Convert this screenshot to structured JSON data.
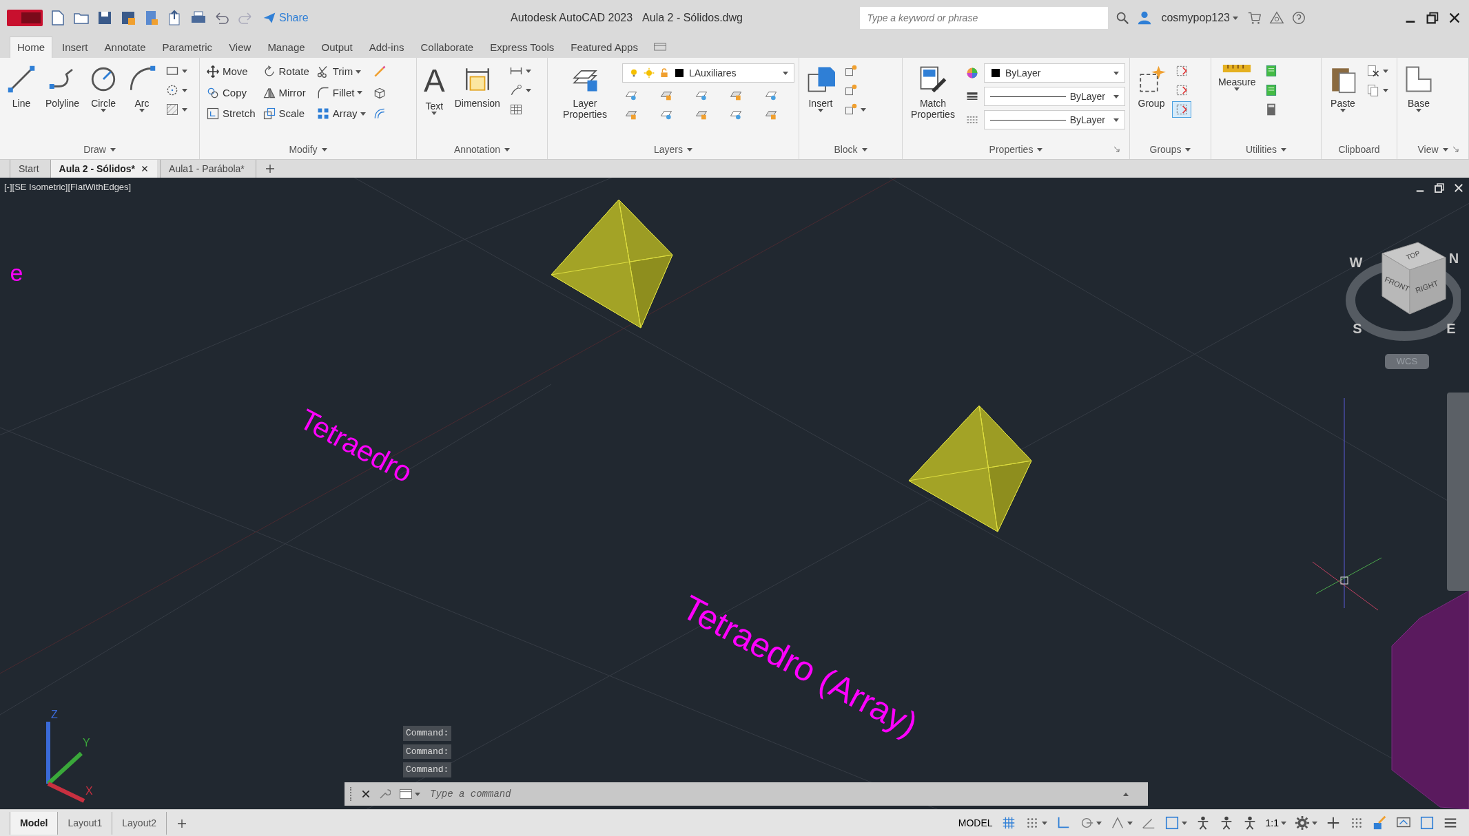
{
  "title_bar": {
    "share": "Share",
    "app_title": "Autodesk AutoCAD 2023",
    "file_name": "Aula 2 - Sólidos.dwg",
    "search": {
      "placeholder": "Type a keyword or phrase"
    },
    "user": "cosmypop123"
  },
  "ribbon_tabs": [
    {
      "label": "Home",
      "selected": true
    },
    {
      "label": "Insert",
      "selected": false
    },
    {
      "label": "Annotate",
      "selected": false
    },
    {
      "label": "Parametric",
      "selected": false
    },
    {
      "label": "View",
      "selected": false
    },
    {
      "label": "Manage",
      "selected": false
    },
    {
      "label": "Output",
      "selected": false
    },
    {
      "label": "Add-ins",
      "selected": false
    },
    {
      "label": "Collaborate",
      "selected": false
    },
    {
      "label": "Express Tools",
      "selected": false
    },
    {
      "label": "Featured Apps",
      "selected": false
    }
  ],
  "ribbon_panels": [
    {
      "title": "Draw",
      "menu": true,
      "launcher": false,
      "large": [
        {
          "label": "Line",
          "dropdown": false
        },
        {
          "label": "Polyline",
          "dropdown": false
        },
        {
          "label": "Circle",
          "dropdown": true
        },
        {
          "label": "Arc",
          "dropdown": true
        }
      ],
      "rows": [
        [
          {
            "kind": "icon",
            "dropdown": true
          }
        ],
        [
          {
            "kind": "icon",
            "dropdown": true
          }
        ],
        [
          {
            "kind": "icon",
            "dropdown": true
          }
        ]
      ]
    },
    {
      "title": "Modify",
      "menu": true,
      "launcher": false,
      "rows": [
        [
          {
            "kind": "small",
            "label": "Move",
            "dropdown": false
          },
          {
            "kind": "small",
            "label": "Rotate",
            "dropdown": false
          },
          {
            "kind": "small",
            "label": "Trim",
            "dropdown": true
          },
          {
            "kind": "icon",
            "dropdown": false
          }
        ],
        [
          {
            "kind": "small",
            "label": "Copy",
            "dropdown": false
          },
          {
            "kind": "small",
            "label": "Mirror",
            "dropdown": false
          },
          {
            "kind": "small",
            "label": "Fillet",
            "dropdown": true
          },
          {
            "kind": "icon",
            "dropdown": false
          }
        ],
        [
          {
            "kind": "small",
            "label": "Stretch",
            "dropdown": false
          },
          {
            "kind": "small",
            "label": "Scale",
            "dropdown": false
          },
          {
            "kind": "small",
            "label": "Array",
            "dropdown": true
          },
          {
            "kind": "icon",
            "dropdown": false
          }
        ]
      ]
    },
    {
      "title": "Annotation",
      "menu": true,
      "launcher": false,
      "large": [
        {
          "label": "Text",
          "glyph": "A",
          "dropdown": true
        },
        {
          "label": "Dimension",
          "dropdown": false
        }
      ],
      "rows": [
        [
          {
            "kind": "icon",
            "dropdown": true
          }
        ],
        [
          {
            "kind": "icon",
            "dropdown": true
          }
        ],
        [
          {
            "kind": "icon",
            "dropdown": false
          }
        ]
      ]
    },
    {
      "title": "Layers",
      "menu": true,
      "launcher": false,
      "large": [
        {
          "label": "Layer Properties",
          "dropdown": false
        }
      ],
      "rows": [
        [
          {
            "kind": "select",
            "value": "LAuxiliares"
          }
        ],
        [
          {
            "kind": "icon",
            "dropdown": false
          },
          {
            "kind": "icon",
            "dropdown": false
          },
          {
            "kind": "icon",
            "dropdown": false
          },
          {
            "kind": "icon",
            "dropdown": false
          },
          {
            "kind": "icon",
            "dropdown": false
          }
        ],
        [
          {
            "kind": "icon",
            "dropdown": false
          },
          {
            "kind": "icon",
            "dropdown": false
          },
          {
            "kind": "icon",
            "dropdown": false
          },
          {
            "kind": "icon",
            "dropdown": false
          },
          {
            "kind": "icon",
            "dropdown": false
          }
        ]
      ]
    },
    {
      "title": "Block",
      "menu": true,
      "launcher": false,
      "large": [
        {
          "label": "Insert",
          "dropdown": true
        }
      ],
      "rows": [
        [
          {
            "kind": "icon",
            "dropdown": false
          }
        ],
        [
          {
            "kind": "icon",
            "dropdown": false
          }
        ],
        [
          {
            "kind": "icon",
            "dropdown": true
          }
        ]
      ]
    },
    {
      "title": "Properties",
      "menu": true,
      "launcher": true,
      "large": [
        {
          "label": "Match Properties",
          "dropdown": false
        }
      ],
      "rows": [
        [
          {
            "kind": "icon",
            "dropdown": false
          },
          {
            "kind": "select",
            "value": "ByLayer"
          }
        ],
        [
          {
            "kind": "icon",
            "dropdown": false
          },
          {
            "kind": "select",
            "value": "ByLayer"
          }
        ],
        [
          {
            "kind": "icon",
            "dropdown": false
          },
          {
            "kind": "select",
            "value": "ByLayer"
          }
        ]
      ]
    },
    {
      "title": "Groups",
      "menu": true,
      "launcher": false,
      "large": [
        {
          "label": "Group",
          "dropdown": false
        }
      ],
      "rows": [
        [
          {
            "kind": "icon",
            "dropdown": false,
            "on": false
          }
        ],
        [
          {
            "kind": "icon",
            "dropdown": false,
            "on": false
          }
        ],
        [
          {
            "kind": "icon",
            "dropdown": false,
            "on": true
          }
        ]
      ]
    },
    {
      "title": "Utilities",
      "menu": true,
      "launcher": false,
      "large": [
        {
          "label": "Measure",
          "dropdown": true
        }
      ],
      "rows": [
        [
          {
            "kind": "icon",
            "dropdown": false
          }
        ],
        [
          {
            "kind": "icon",
            "dropdown": false
          }
        ],
        [
          {
            "kind": "icon",
            "dropdown": false
          }
        ]
      ]
    },
    {
      "title": "Clipboard",
      "menu": false,
      "launcher": false,
      "large": [
        {
          "label": "Paste",
          "dropdown": true
        }
      ],
      "rows": [
        [
          {
            "kind": "icon",
            "dropdown": true
          }
        ],
        [
          {
            "kind": "icon",
            "dropdown": true
          }
        ]
      ]
    },
    {
      "title": "View",
      "menu": true,
      "launcher": true,
      "large": [
        {
          "label": "Base",
          "dropdown": true
        }
      ]
    }
  ],
  "document_tabs": [
    {
      "label": "Start",
      "selected": false,
      "closable": false
    },
    {
      "label": "Aula 2 - Sólidos*",
      "selected": true,
      "closable": true
    },
    {
      "label": "Aula1 - Parábola*",
      "selected": false,
      "closable": false
    }
  ],
  "viewport": {
    "label": "[-][SE Isometric][FlatWithEdges]",
    "texts": [
      {
        "text": "e"
      },
      {
        "text": "Tetraedro"
      },
      {
        "text": "Tetraedro (Array)"
      }
    ],
    "viewcube": {
      "faces": [
        "TOP",
        "FRONT",
        "RIGHT"
      ],
      "compass": [
        "W",
        "N",
        "S",
        "E"
      ],
      "ucs": "WCS"
    },
    "ucs_axes": [
      "Z",
      "Y",
      "X"
    ]
  },
  "command_history": [
    "Command:",
    "Command:",
    "Command:"
  ],
  "command_line": {
    "placeholder": "Type a command"
  },
  "layout_tabs": [
    {
      "label": "Model",
      "selected": true
    },
    {
      "label": "Layout1",
      "selected": false
    },
    {
      "label": "Layout2",
      "selected": false
    }
  ],
  "status_bar": {
    "space": "MODEL",
    "scale": "1:1"
  }
}
